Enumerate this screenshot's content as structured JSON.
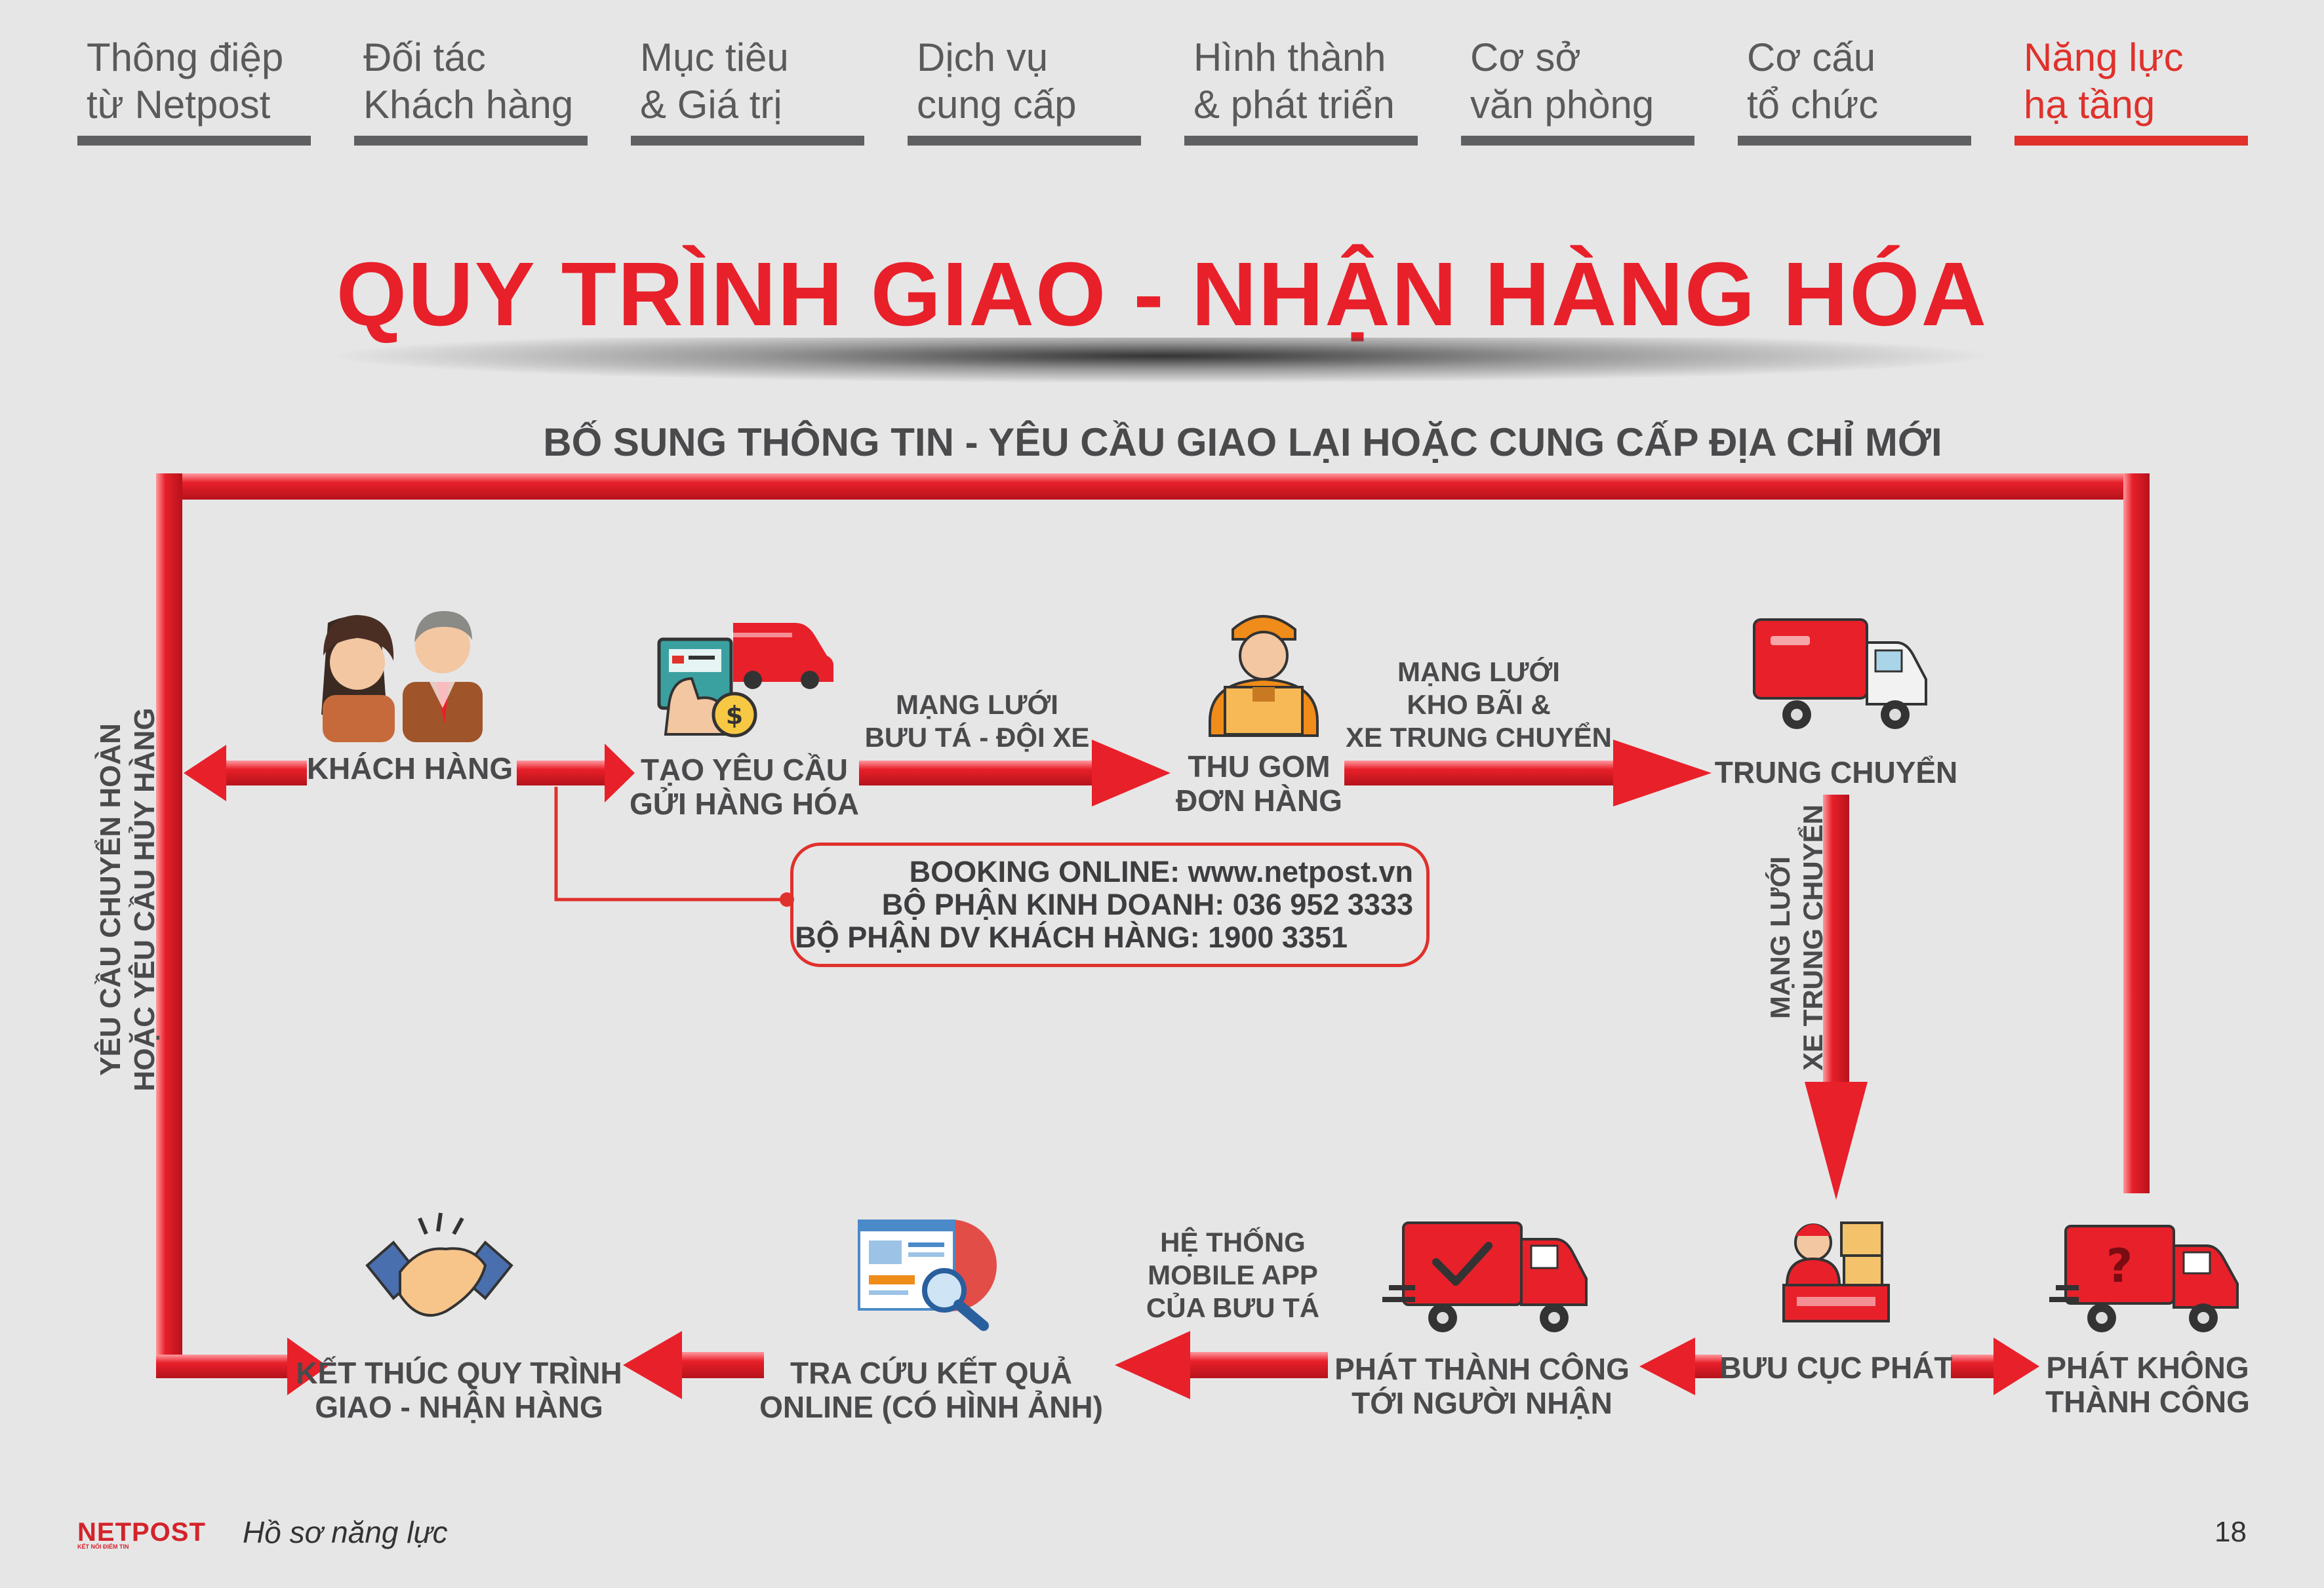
{
  "nav": [
    {
      "label": "Thông điệp\ntừ Netpost",
      "active": false
    },
    {
      "label": "Đối tác\nKhách hàng",
      "active": false
    },
    {
      "label": "Mục tiêu\n& Giá trị",
      "active": false
    },
    {
      "label": "Dịch vụ\ncung cấp",
      "active": false
    },
    {
      "label": "Hình thành\n& phát triển",
      "active": false
    },
    {
      "label": "Cơ sở\nvăn phòng",
      "active": false
    },
    {
      "label": "Cơ cấu\ntổ chức",
      "active": false
    },
    {
      "label": "Năng lực\nhạ tầng",
      "active": true
    }
  ],
  "title": "QUY TRÌNH GIAO - NHẬN HÀNG HÓA",
  "loop_top_label": "BỐ SUNG THÔNG TIN - YÊU CẦU GIAO LẠI HOẶC CUNG CẤP ĐỊA CHỈ MỚI",
  "loop_left_label": "YÊU CẦU CHUYỂN HOÀN\nHOẶC YÊU CẦU HỦY HÀNG",
  "nodes": {
    "customer": "KHÁCH HÀNG",
    "create_request": "TẠO YÊU CẦU\nGỬI HÀNG HÓA",
    "pickup": "THU GOM\nĐƠN HÀNG",
    "transit": "TRUNG CHUYỂN",
    "post_office": "BƯU CỤC PHÁT",
    "delivery_failed": "PHÁT KHÔNG\nTHÀNH CÔNG",
    "delivery_success": "PHÁT THÀNH CÔNG\nTỚI NGƯỜI NHẬN",
    "lookup": "TRA CỨU KẾT QUẢ\nONLINE (CÓ HÌNH ẢNH)",
    "end": "KẾT THÚC QUY TRÌNH\nGIAO - NHẬN HÀNG"
  },
  "edges": {
    "request_to_pickup": "MẠNG LƯỚI\nBƯU TÁ - ĐỘI XE",
    "pickup_to_transit": "MẠNG LƯỚI\nKHO BÃI &\nXE TRUNG CHUYỂN",
    "transit_to_post": "MẠNG LƯỚI\nXE TRUNG CHUYỂN",
    "success_to_lookup": "HỆ THỐNG\nMOBILE APP\nCỦA BƯU TÁ"
  },
  "contact": {
    "booking": "BOOKING ONLINE: www.netpost.vn",
    "sales": "BỘ PHẬN KINH DOANH: 036 952 3333",
    "support": "BỘ PHẬN DV KHÁCH HÀNG: 1900 3351"
  },
  "footer": {
    "logo": "NETPOST",
    "logo_tagline": "KẾT NỐI ĐIỂM TIN",
    "text": "Hồ sơ năng lực",
    "page": "18"
  },
  "icons": {
    "customer": "people-icon",
    "create_request": "order-truck-icon",
    "pickup": "courier-icon",
    "transit": "transit-truck-icon",
    "post_office": "post-office-icon",
    "delivery_failed": "truck-question-icon",
    "delivery_success": "truck-check-icon",
    "lookup": "search-report-icon",
    "end": "handshake-icon"
  },
  "colors": {
    "accent": "#e0312b",
    "arrow": "#e8202a",
    "text": "#4a4a4c",
    "background": "#e6e6e7",
    "nav_inactive": "#5f6062"
  }
}
